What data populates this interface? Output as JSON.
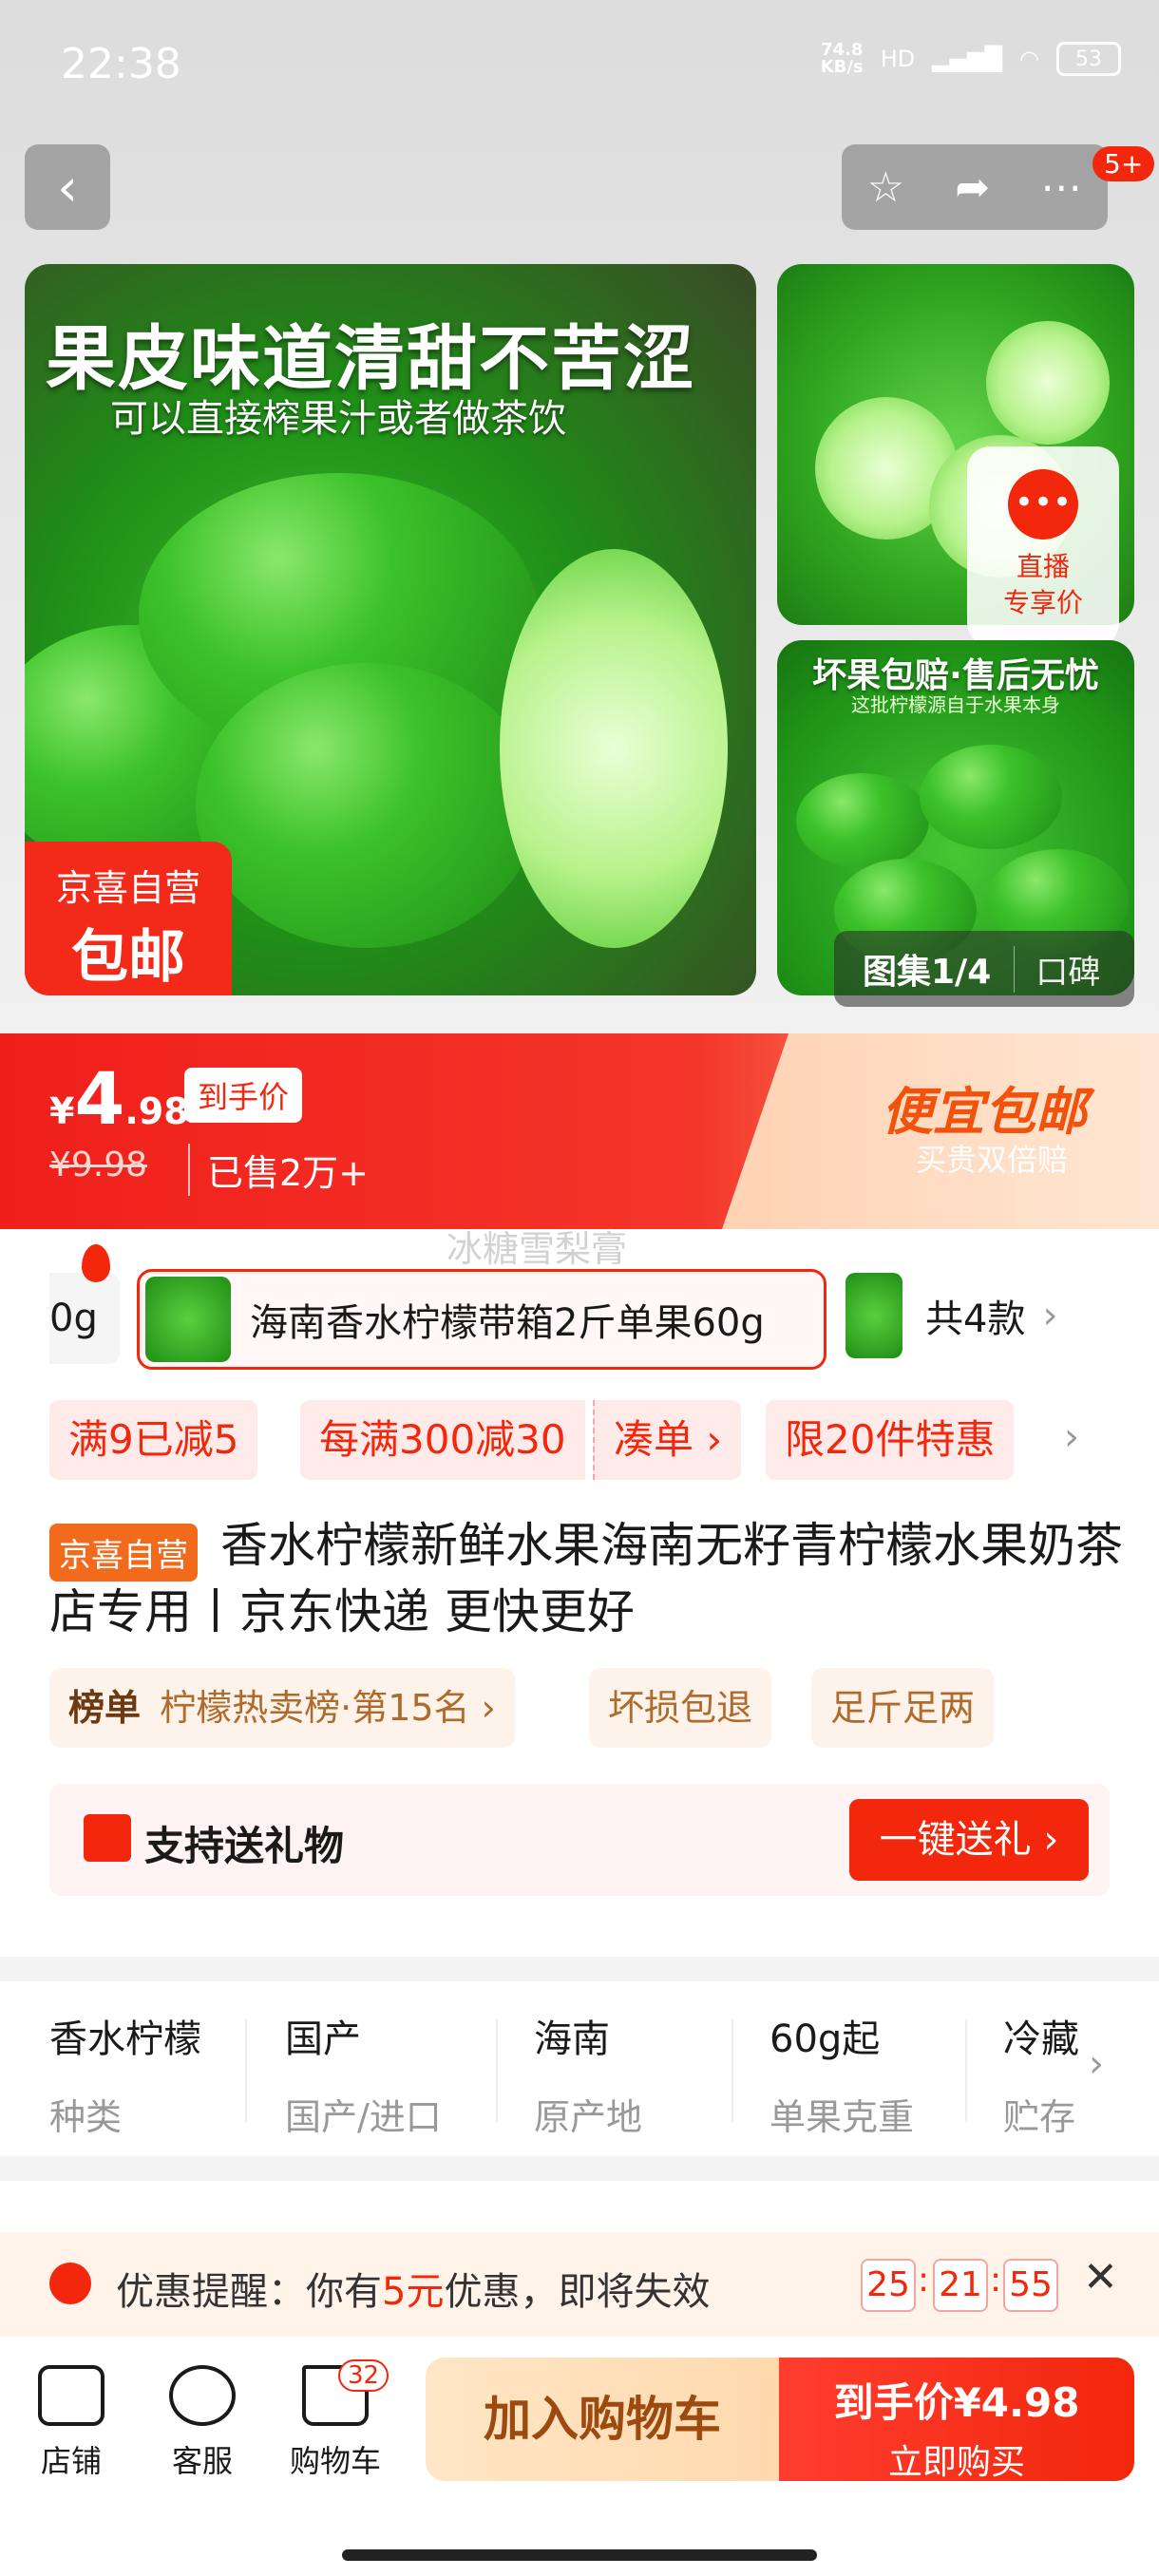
{
  "status": {
    "time": "22:38",
    "net_speed": "74.8\nKB/s",
    "net_label": "HD",
    "battery": "53"
  },
  "header": {
    "back": "‹",
    "badge": "5+"
  },
  "hero": {
    "main_headline": "果皮味道清甜不苦涩",
    "main_subline": "可以直接榨果汁或者做茶饮",
    "tag_line1": "京喜自营",
    "tag_line2": "包邮",
    "live_line1": "直播",
    "live_line2": "专享价",
    "side_title": "坏果包赔·售后无忧",
    "side_sub": "这批柠檬源自于水果本身",
    "gallery": "图集1/4",
    "reviews": "口碑"
  },
  "price": {
    "currency": "¥",
    "integer": "4",
    "decimal": ".98",
    "tag": "到手价",
    "original": "¥9.98",
    "sold": "已售2万+",
    "promo_title": "便宜包邮",
    "promo_sub": "买贵双倍赔",
    "ghost_text": "冰糖雪梨膏"
  },
  "variants": {
    "left_partial": "0g",
    "selected": "海南香水柠檬带箱2斤单果60g",
    "count": "共4款"
  },
  "coupons": [
    "满9已减5",
    "每满300减30",
    "凑单 ›",
    "限20件特惠"
  ],
  "product": {
    "badge": "京喜自营",
    "title": "香水柠檬新鲜水果海南无籽青柠檬水果奶茶店专用丨京东快递 更快更好"
  },
  "chips": {
    "rank_label": "榜单",
    "rank_text": "柠檬热卖榜·第15名 ›",
    "chip2": "坏损包退",
    "chip3": "足斤足两"
  },
  "gift": {
    "label": "支持送礼物",
    "button": "一键送礼 ›"
  },
  "attributes": [
    {
      "value": "香水柠檬",
      "key": "种类"
    },
    {
      "value": "国产",
      "key": "国产/进口"
    },
    {
      "value": "海南",
      "key": "原产地"
    },
    {
      "value": "60g起",
      "key": "单果克重"
    },
    {
      "value": "冷藏",
      "key": "贮存"
    }
  ],
  "reminder": {
    "prefix": "优惠提醒：你有",
    "amount": "5元",
    "suffix": "优惠，即将失效",
    "h": "25",
    "m": "21",
    "s": "55"
  },
  "bottom": {
    "store": "店铺",
    "service": "客服",
    "cart": "购物车",
    "cart_count": "32",
    "add_cart": "加入购物车",
    "buy_line1": "到手价¥4.98",
    "buy_line2": "立即购买"
  }
}
